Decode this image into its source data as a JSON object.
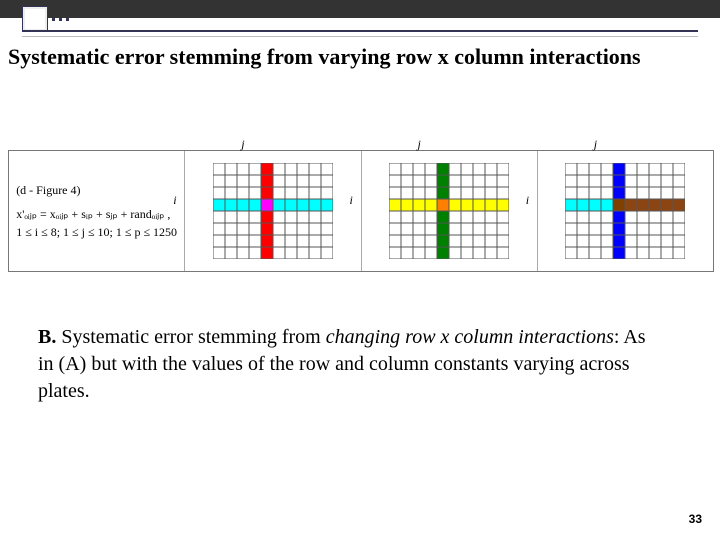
{
  "title": "Systematic error stemming from varying row x column interactions",
  "figure": {
    "caption": "(d - Figure 4)",
    "formula": "x'ₒᵢⱼₚ = xₒᵢⱼₚ + sᵢₚ + sⱼₚ + randₒᵢⱼₚ ,",
    "bounds": "1 ≤ i ≤ 8; 1 ≤ j ≤ 10; 1 ≤ p ≤ 1250",
    "axis_i": "i",
    "axis_j": "j",
    "grids": [
      {
        "row_color": "#00FFFF",
        "col_color": "#FF0000",
        "inter_color": "#FF00FF"
      },
      {
        "row_color": "#FFFF00",
        "col_color": "#008000",
        "inter_color": "#FF8000"
      },
      {
        "row_color": "#00FFFF",
        "col_color": "#0000FF",
        "inter_color": "#804000",
        "row_brown": true
      }
    ]
  },
  "paragraph": {
    "lead": "B.",
    "ital_part": "changing row x  column interactions",
    "pre": " Systematic error stemming from ",
    "post": ": As in (A) but with the values of the row and column constants varying across plates."
  },
  "page_number": "33"
}
